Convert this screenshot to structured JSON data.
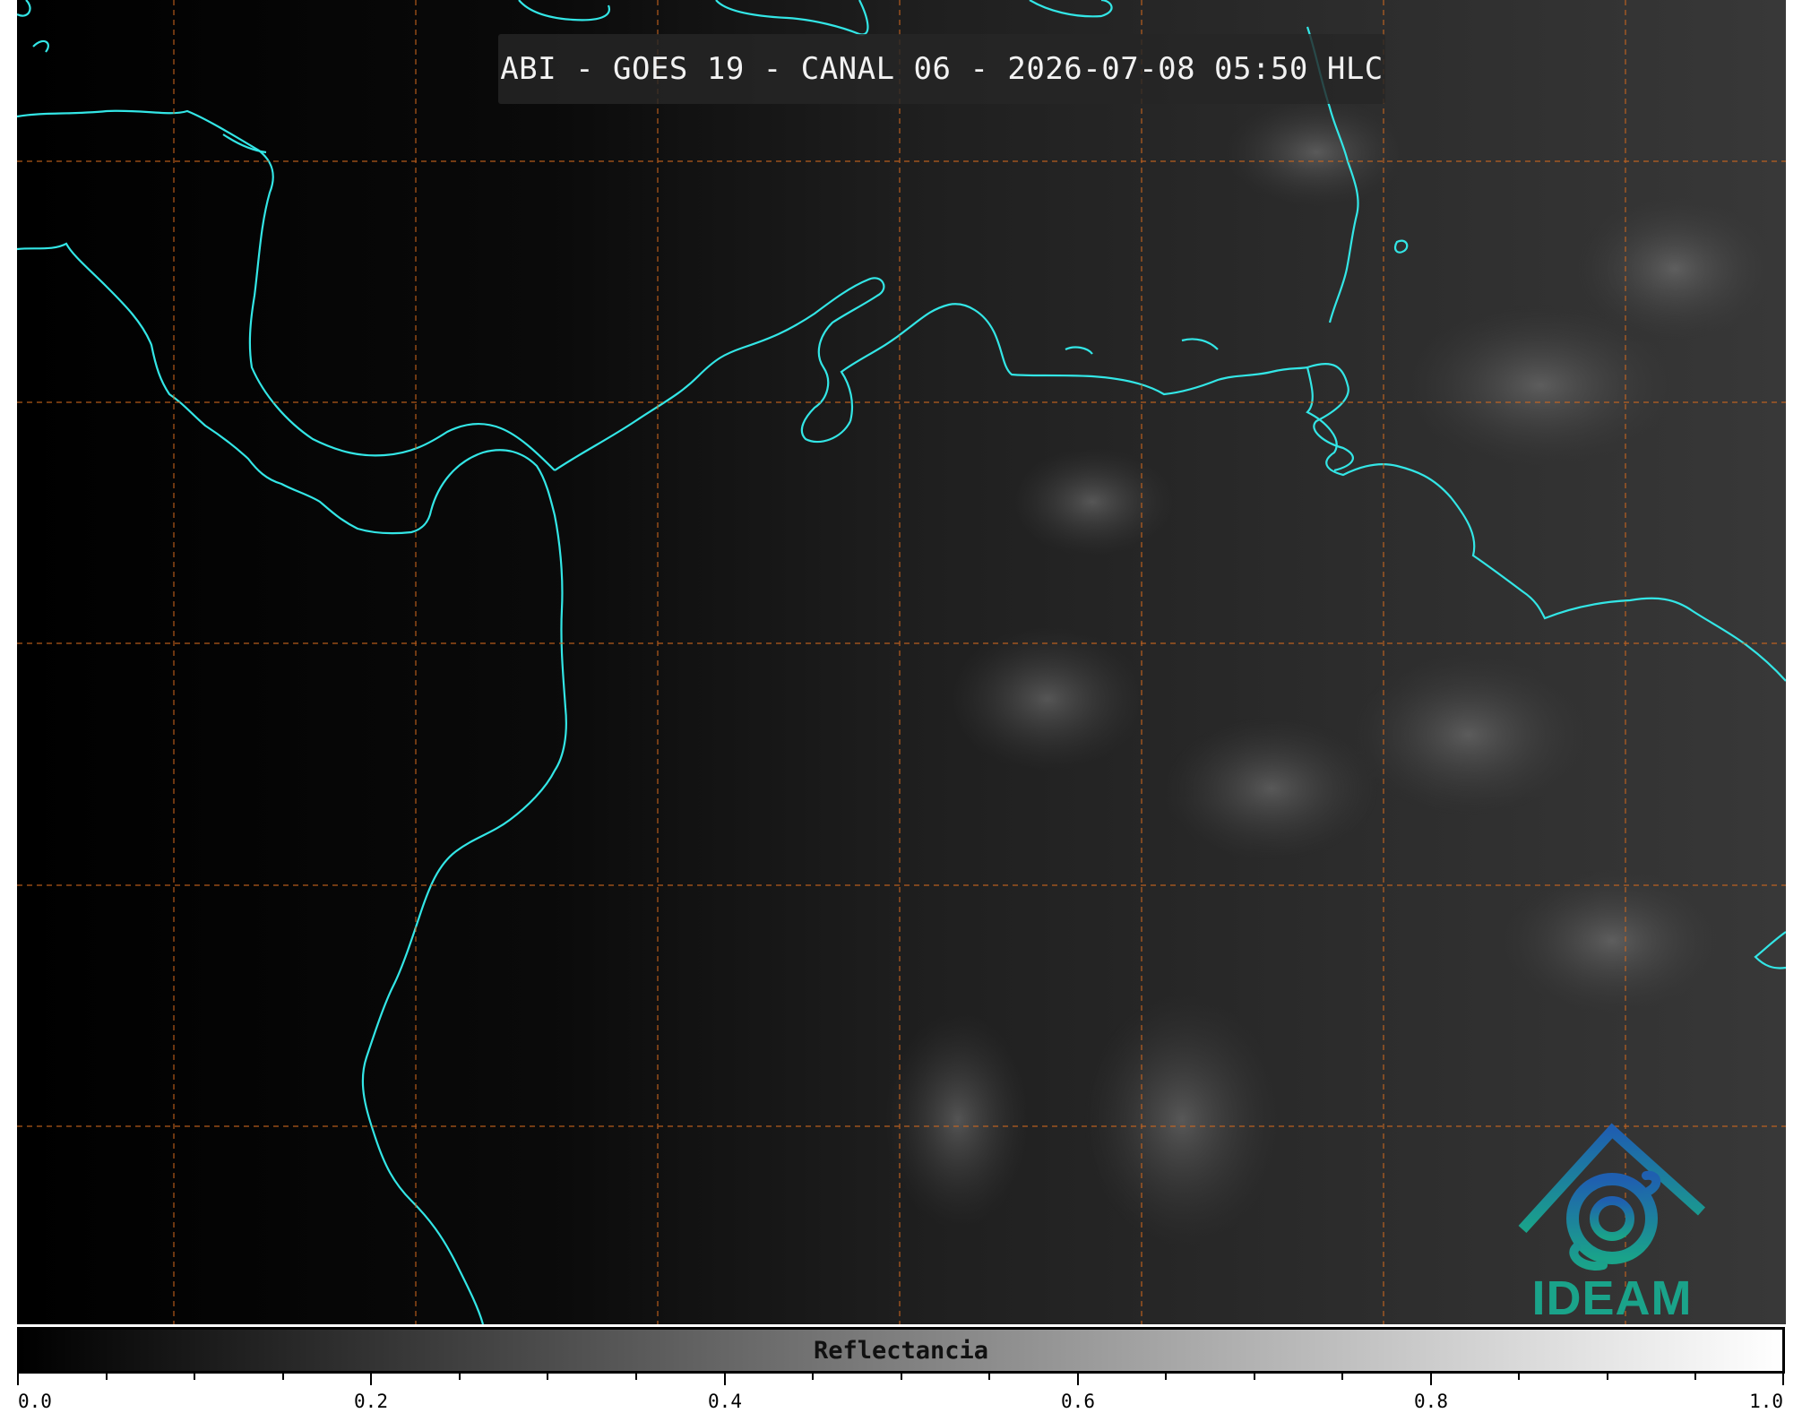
{
  "title": "ABI - GOES 19 - CANAL 06 - 2026-07-08 05:50 HLC",
  "colorbar": {
    "label": "Reflectancia",
    "ticks": [
      "0.0",
      "0.2",
      "0.4",
      "0.6",
      "0.8",
      "1.0"
    ],
    "range": [
      0.0,
      1.0
    ],
    "colormap": "greyscale"
  },
  "logo": {
    "text": "IDEAM"
  },
  "colors": {
    "coastline": "#33e6e6",
    "gridlines": "#d2691e",
    "background": "#000000",
    "brand": "#1aa38a"
  }
}
